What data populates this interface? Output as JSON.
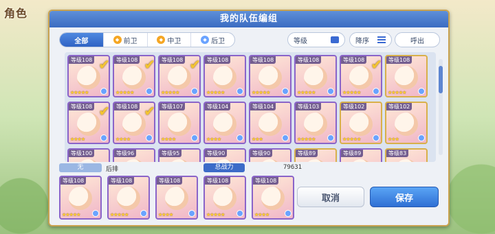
{
  "background": {
    "title": "角色"
  },
  "dialog": {
    "title": "我的队伍编组"
  },
  "filters": [
    {
      "label": "全部",
      "icon": "",
      "active": true
    },
    {
      "label": "前卫",
      "icon": "front-role-icon",
      "active": false
    },
    {
      "label": "中卫",
      "icon": "middle-role-icon",
      "active": false
    },
    {
      "label": "后卫",
      "icon": "back-role-icon",
      "active": false
    }
  ],
  "sort": {
    "level_label": "等级",
    "order_label": "降序",
    "callout_label": "呼出"
  },
  "roster_rows": [
    [
      {
        "level": "等级108",
        "stars": "★★★★★",
        "selected": true,
        "frame": "purple"
      },
      {
        "level": "等级108",
        "stars": "★★★★★",
        "selected": true,
        "frame": "purple"
      },
      {
        "level": "等级108",
        "stars": "★★★★★",
        "selected": true,
        "frame": "purple"
      },
      {
        "level": "等级108",
        "stars": "★★★★★",
        "selected": false,
        "frame": "purple"
      },
      {
        "level": "等级108",
        "stars": "★★★★★",
        "selected": false,
        "frame": "purple"
      },
      {
        "level": "等级108",
        "stars": "★★★★★",
        "selected": false,
        "frame": "purple"
      },
      {
        "level": "等级108",
        "stars": "★★★★★",
        "selected": true,
        "frame": "purple"
      },
      {
        "level": "等级108",
        "stars": "★★★★★",
        "selected": false,
        "frame": "gold"
      }
    ],
    [
      {
        "level": "等级108",
        "stars": "★★★★",
        "selected": true,
        "frame": "purple"
      },
      {
        "level": "等级108",
        "stars": "★★★★",
        "selected": true,
        "frame": "purple"
      },
      {
        "level": "等级107",
        "stars": "★★★★",
        "selected": false,
        "frame": "purple"
      },
      {
        "level": "等级104",
        "stars": "★★★★",
        "selected": false,
        "frame": "purple"
      },
      {
        "level": "等级104",
        "stars": "★★★",
        "selected": false,
        "frame": "purple"
      },
      {
        "level": "等级103",
        "stars": "★★★★★",
        "selected": false,
        "frame": "purple"
      },
      {
        "level": "等级102",
        "stars": "★★★★★",
        "selected": false,
        "frame": "gold"
      },
      {
        "level": "等级102",
        "stars": "★★★",
        "selected": false,
        "frame": "gold"
      }
    ],
    [
      {
        "level": "等级100",
        "stars": "",
        "selected": false,
        "frame": "purple"
      },
      {
        "level": "等级96",
        "stars": "",
        "selected": false,
        "frame": "purple"
      },
      {
        "level": "等级95",
        "stars": "",
        "selected": false,
        "frame": "purple"
      },
      {
        "level": "等级90",
        "stars": "",
        "selected": false,
        "frame": "purple"
      },
      {
        "level": "等级90",
        "stars": "",
        "selected": false,
        "frame": "purple"
      },
      {
        "level": "等级89",
        "stars": "",
        "selected": false,
        "frame": "gold"
      },
      {
        "level": "等级89",
        "stars": "",
        "selected": false,
        "frame": "purple"
      },
      {
        "level": "等级83",
        "stars": "",
        "selected": false,
        "frame": "gold"
      }
    ]
  ],
  "info": {
    "position_tag": "无",
    "back_label": "后排",
    "power_label": "总战力",
    "power_value": "79631"
  },
  "team": [
    {
      "level": "等级108",
      "stars": "★★★★★"
    },
    {
      "level": "等级108",
      "stars": "★★★★★"
    },
    {
      "level": "等级108",
      "stars": "★★★★"
    },
    {
      "level": "等级108",
      "stars": "★★★★★"
    },
    {
      "level": "等级108",
      "stars": "★★★★"
    }
  ],
  "actions": {
    "cancel_label": "取消",
    "save_label": "保存"
  }
}
